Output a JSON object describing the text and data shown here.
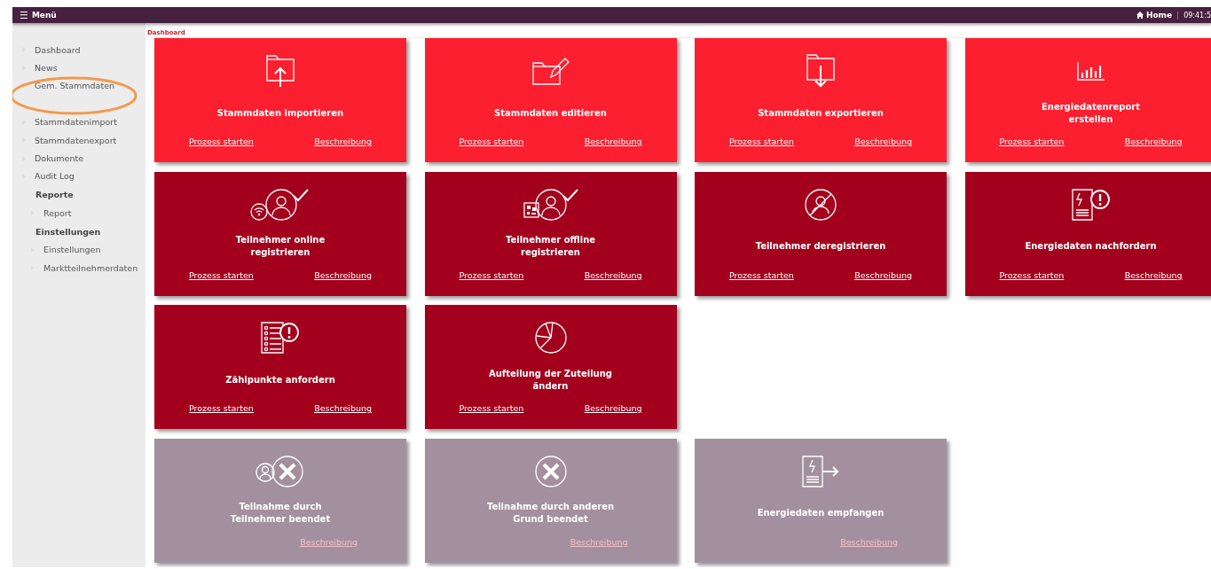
{
  "topbar": {
    "menu_icon": "☰",
    "menu_label": "Menü",
    "home_label": "Home",
    "separator": "|",
    "time": "09:41:5"
  },
  "sidebar": {
    "items": [
      {
        "kind": "link",
        "label": "Dashboard"
      },
      {
        "kind": "link",
        "label": "News"
      },
      {
        "kind": "link",
        "label": "Gem. Stammdaten"
      },
      {
        "kind": "link",
        "label": "Stammdatenimport"
      },
      {
        "kind": "link",
        "label": "Stammdatenexport"
      },
      {
        "kind": "link",
        "label": "Dokumente"
      },
      {
        "kind": "link",
        "label": "Audit Log"
      },
      {
        "kind": "section",
        "label": "Reporte",
        "children": [
          {
            "kind": "link",
            "label": "Report"
          }
        ]
      },
      {
        "kind": "section",
        "label": "Einstellungen",
        "children": [
          {
            "kind": "link",
            "label": "Einstellungen"
          },
          {
            "kind": "link",
            "label": "Marktteilnehmerdaten"
          }
        ]
      }
    ]
  },
  "breadcrumb": "Dashboard",
  "tile_rows": [
    [
      {
        "kind": "bright",
        "title": "Stammdaten importieren",
        "links": [
          "Prozess starten",
          "Beschreibung"
        ]
      },
      {
        "kind": "bright",
        "title": "Stammdaten editieren",
        "links": [
          "Prozess starten",
          "Beschreibung"
        ]
      },
      {
        "kind": "bright",
        "title": "Stammdaten exportieren",
        "links": [
          "Prozess starten",
          "Beschreibung"
        ]
      },
      {
        "kind": "bright",
        "title": "Energiedatenreport erstellen",
        "links": [
          "Prozess starten",
          "Beschreibung"
        ]
      }
    ],
    [
      {
        "kind": "dark",
        "title": "Teilnehmer online registrieren",
        "links": [
          "Prozess starten",
          "Beschreibung"
        ]
      },
      {
        "kind": "dark",
        "title": "Teilnehmer offline registrieren",
        "links": [
          "Prozess starten",
          "Beschreibung"
        ]
      },
      {
        "kind": "dark",
        "title": "Teilnehmer deregistrieren",
        "links": [
          "Prozess starten",
          "Beschreibung"
        ]
      },
      {
        "kind": "dark",
        "title": "Energiedaten nachfordern",
        "links": [
          "Prozess starten",
          "Beschreibung"
        ]
      }
    ],
    [
      {
        "kind": "dark",
        "title": "Zählpunkte anfordern",
        "links": [
          "Prozess starten",
          "Beschreibung"
        ]
      },
      {
        "kind": "dark",
        "title": "Aufteilung der Zuteilung ändern",
        "links": [
          "Prozess starten",
          "Beschreibung"
        ]
      }
    ],
    [
      {
        "kind": "muted",
        "title": "Teilnahme durch Teilnehmer beendet",
        "links": [
          "Beschreibung"
        ]
      },
      {
        "kind": "muted",
        "title": "Teilnahme durch anderen Grund beendet",
        "links": [
          "Beschreibung"
        ]
      },
      {
        "kind": "muted",
        "title": "Energiedaten empfangen",
        "links": [
          "Beschreibung"
        ]
      }
    ]
  ]
}
